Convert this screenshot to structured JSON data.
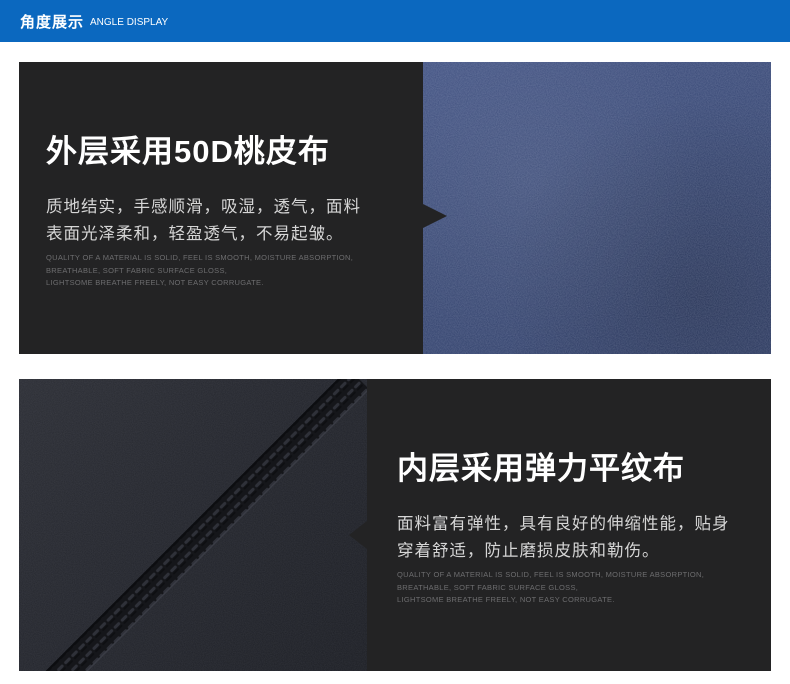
{
  "header": {
    "title_cn": "角度展示",
    "title_en": "ANGLE DISPLAY",
    "background": "#0b68bf"
  },
  "panels": [
    {
      "heading": "外层采用50D桃皮布",
      "desc_line1": "质地结实，手感顺滑，吸湿，透气，面料",
      "desc_line2": "表面光泽柔和，轻盈透气，不易起皱。",
      "en_line1": "QUALITY OF A MATERIAL IS SOLID, FEEL IS SMOOTH, MOISTURE ABSORPTION,",
      "en_line2": "BREATHABLE, SOFT FABRIC SURFACE GLOSS,",
      "en_line3": "LIGHTSOME BREATHE FREELY, NOT EASY CORRUGATE.",
      "image": "blue-peach-skin-fabric-photo"
    },
    {
      "heading": "内层采用弹力平纹布",
      "desc_line1": "面料富有弹性，具有良好的伸缩性能，贴身",
      "desc_line2": "穿着舒适，防止磨损皮肤和勒伤。",
      "en_line1": "QUALITY OF A MATERIAL IS SOLID, FEEL IS SMOOTH, MOISTURE ABSORPTION,",
      "en_line2": "BREATHABLE, SOFT FABRIC SURFACE GLOSS,",
      "en_line3": "LIGHTSOME BREATHE FREELY, NOT EASY CORRUGATE.",
      "image": "dark-stretch-fabric-seam-photo"
    }
  ],
  "colors": {
    "panel_bg": "#232324",
    "blue_fabric": "#33436f",
    "dark_fabric": "#22242b"
  }
}
